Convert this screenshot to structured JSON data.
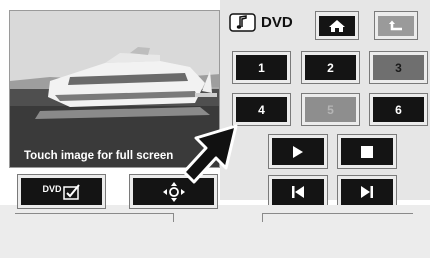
{
  "video": {
    "caption": "Touch image for full screen"
  },
  "header": {
    "title": "DVD",
    "title_icon": "dvd-music-icon",
    "home_icon": "home-icon",
    "back_icon": "back-arrow-icon"
  },
  "keypad": {
    "keys": [
      "1",
      "2",
      "3",
      "4",
      "5",
      "6"
    ],
    "states": [
      "active",
      "active",
      "selected",
      "active",
      "disabled",
      "active"
    ]
  },
  "transport": {
    "play_icon": "play-icon",
    "stop_icon": "stop-icon",
    "prev_icon": "skip-previous-icon",
    "next_icon": "skip-next-icon"
  },
  "bottom_buttons": {
    "dvd_menu_label": "DVD",
    "dvd_menu_icon": "dvd-menu-icon",
    "navigation_icon": "directional-pad-icon"
  },
  "colors": {
    "button_dark": "#141414",
    "button_disabled": "#8e8e8e",
    "panel": "#e6e6e6"
  }
}
